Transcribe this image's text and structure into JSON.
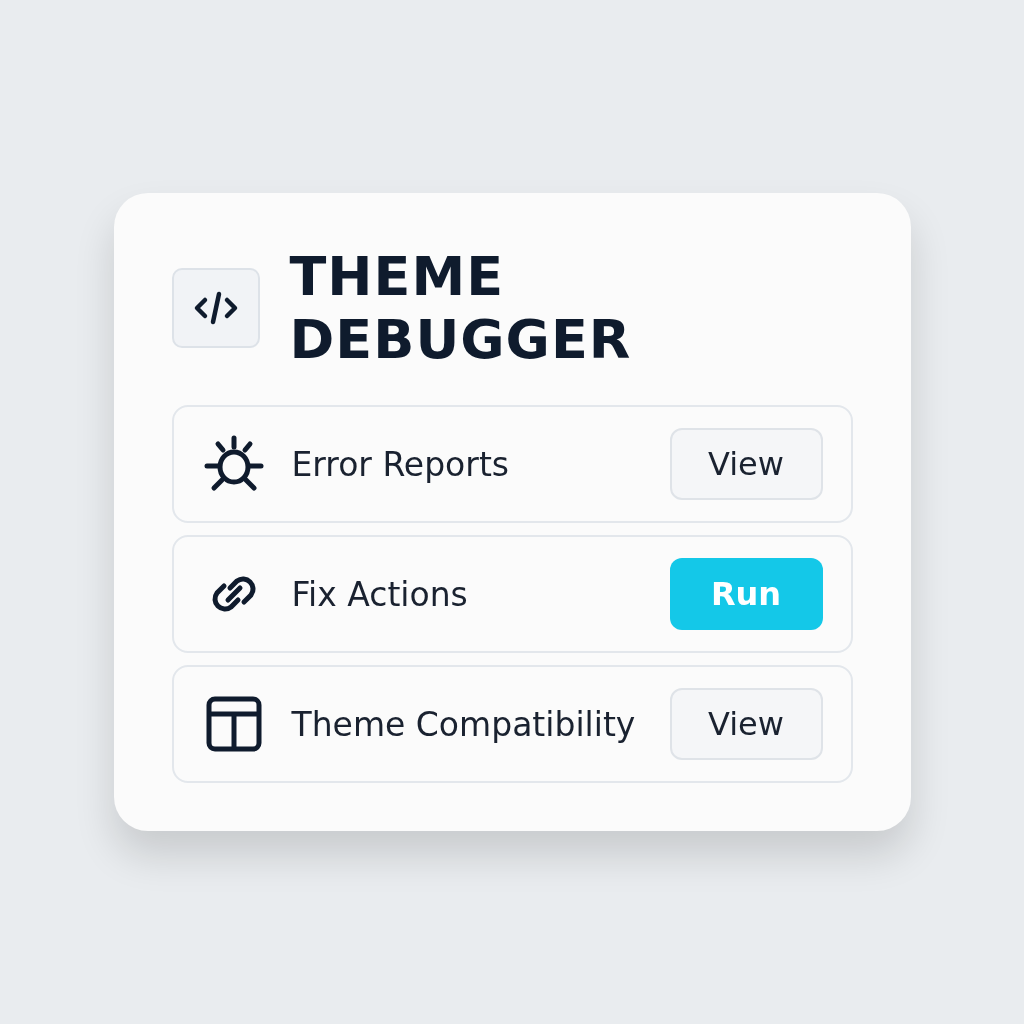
{
  "title": "THEME DEBUGGER",
  "rows": [
    {
      "label": "Error Reports",
      "button": {
        "label": "View",
        "primary": false
      }
    },
    {
      "label": "Fix Actions",
      "button": {
        "label": "Run",
        "primary": true
      }
    },
    {
      "label": "Theme Compatibility",
      "button": {
        "label": "View",
        "primary": false
      }
    }
  ]
}
